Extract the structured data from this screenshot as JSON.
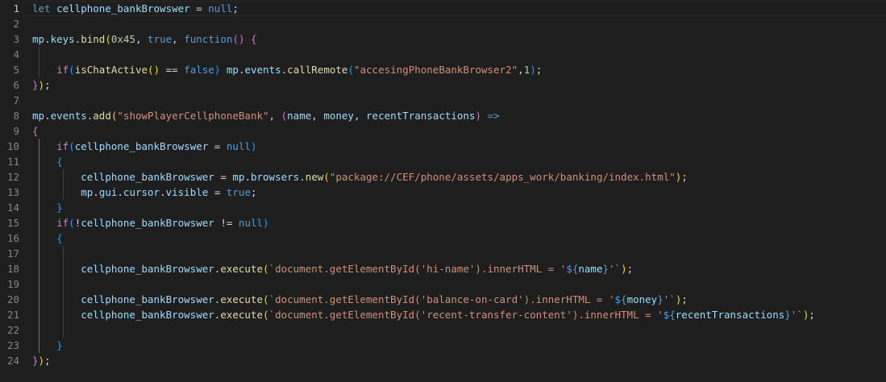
{
  "editor": {
    "language": "javascript",
    "active_line": 1,
    "line_numbers": [
      "1",
      "2",
      "3",
      "4",
      "5",
      "6",
      "7",
      "8",
      "9",
      "10",
      "11",
      "12",
      "13",
      "14",
      "15",
      "16",
      "17",
      "18",
      "19",
      "20",
      "21",
      "22",
      "23",
      "24"
    ],
    "lines": [
      [
        {
          "t": "let",
          "c": "kw"
        },
        {
          "t": " "
        },
        {
          "t": "cellphone_bankBrowswer",
          "c": "var"
        },
        {
          "t": " = "
        },
        {
          "t": "null",
          "c": "kw"
        },
        {
          "t": ";"
        }
      ],
      [],
      [
        {
          "t": "mp",
          "c": "var"
        },
        {
          "t": "."
        },
        {
          "t": "keys",
          "c": "var"
        },
        {
          "t": "."
        },
        {
          "t": "bind",
          "c": "fn"
        },
        {
          "t": "(",
          "c": "p1"
        },
        {
          "t": "0x45",
          "c": "num"
        },
        {
          "t": ", "
        },
        {
          "t": "true",
          "c": "kw"
        },
        {
          "t": ", "
        },
        {
          "t": "function",
          "c": "kw"
        },
        {
          "t": "()",
          "c": "p2"
        },
        {
          "t": " "
        },
        {
          "t": "{",
          "c": "p2"
        }
      ],
      [],
      [
        {
          "t": "    "
        },
        {
          "t": "if",
          "c": "ctl"
        },
        {
          "t": "(",
          "c": "p3"
        },
        {
          "t": "isChatActive",
          "c": "fn"
        },
        {
          "t": "()",
          "c": "p1"
        },
        {
          "t": " == "
        },
        {
          "t": "false",
          "c": "kw"
        },
        {
          "t": ")",
          "c": "p3"
        },
        {
          "t": " "
        },
        {
          "t": "mp",
          "c": "var"
        },
        {
          "t": "."
        },
        {
          "t": "events",
          "c": "var"
        },
        {
          "t": "."
        },
        {
          "t": "callRemote",
          "c": "fn"
        },
        {
          "t": "(",
          "c": "p3"
        },
        {
          "t": "\"accesingPhoneBankBrowser2\"",
          "c": "str"
        },
        {
          "t": ","
        },
        {
          "t": "1",
          "c": "num"
        },
        {
          "t": ")",
          "c": "p3"
        },
        {
          "t": ";"
        }
      ],
      [
        {
          "t": "}",
          "c": "p2"
        },
        {
          "t": ")",
          "c": "p1"
        },
        {
          "t": ";"
        }
      ],
      [],
      [
        {
          "t": "mp",
          "c": "var"
        },
        {
          "t": "."
        },
        {
          "t": "events",
          "c": "var"
        },
        {
          "t": "."
        },
        {
          "t": "add",
          "c": "fn"
        },
        {
          "t": "(",
          "c": "p1"
        },
        {
          "t": "\"showPlayerCellphoneBank\"",
          "c": "str"
        },
        {
          "t": ", "
        },
        {
          "t": "(",
          "c": "p2"
        },
        {
          "t": "name",
          "c": "var"
        },
        {
          "t": ", "
        },
        {
          "t": "money",
          "c": "var"
        },
        {
          "t": ", "
        },
        {
          "t": "recentTransactions",
          "c": "var"
        },
        {
          "t": ")",
          "c": "p2"
        },
        {
          "t": " "
        },
        {
          "t": "=>",
          "c": "kw"
        }
      ],
      [
        {
          "t": "{",
          "c": "p2"
        }
      ],
      [
        {
          "t": "    "
        },
        {
          "t": "if",
          "c": "ctl"
        },
        {
          "t": "(",
          "c": "p3"
        },
        {
          "t": "cellphone_bankBrowswer",
          "c": "var"
        },
        {
          "t": " = "
        },
        {
          "t": "null",
          "c": "kw"
        },
        {
          "t": ")",
          "c": "p3"
        }
      ],
      [
        {
          "t": "    "
        },
        {
          "t": "{",
          "c": "p3"
        }
      ],
      [
        {
          "t": "        "
        },
        {
          "t": "cellphone_bankBrowswer",
          "c": "var"
        },
        {
          "t": " = "
        },
        {
          "t": "mp",
          "c": "var"
        },
        {
          "t": "."
        },
        {
          "t": "browsers",
          "c": "var"
        },
        {
          "t": "."
        },
        {
          "t": "new",
          "c": "fn"
        },
        {
          "t": "(",
          "c": "p1"
        },
        {
          "t": "\"package://CEF/phone/assets/apps_work/banking/index.html\"",
          "c": "str"
        },
        {
          "t": ")",
          "c": "p1"
        },
        {
          "t": ";"
        }
      ],
      [
        {
          "t": "        "
        },
        {
          "t": "mp",
          "c": "var"
        },
        {
          "t": "."
        },
        {
          "t": "gui",
          "c": "var"
        },
        {
          "t": "."
        },
        {
          "t": "cursor",
          "c": "var"
        },
        {
          "t": "."
        },
        {
          "t": "visible",
          "c": "var"
        },
        {
          "t": " = "
        },
        {
          "t": "true",
          "c": "kw"
        },
        {
          "t": ";"
        }
      ],
      [
        {
          "t": "    "
        },
        {
          "t": "}",
          "c": "p3"
        }
      ],
      [
        {
          "t": "    "
        },
        {
          "t": "if",
          "c": "ctl"
        },
        {
          "t": "(",
          "c": "p3"
        },
        {
          "t": "!"
        },
        {
          "t": "cellphone_bankBrowswer",
          "c": "var"
        },
        {
          "t": " != "
        },
        {
          "t": "null",
          "c": "kw"
        },
        {
          "t": ")",
          "c": "p3"
        }
      ],
      [
        {
          "t": "    "
        },
        {
          "t": "{",
          "c": "p3"
        }
      ],
      [],
      [
        {
          "t": "        "
        },
        {
          "t": "cellphone_bankBrowswer",
          "c": "var"
        },
        {
          "t": "."
        },
        {
          "t": "execute",
          "c": "fn"
        },
        {
          "t": "(",
          "c": "p1"
        },
        {
          "t": "`document.getElementById('hi-name').innerHTML = '",
          "c": "str"
        },
        {
          "t": "${",
          "c": "tpl"
        },
        {
          "t": "name",
          "c": "var"
        },
        {
          "t": "}",
          "c": "tpl"
        },
        {
          "t": "'`",
          "c": "str"
        },
        {
          "t": ")",
          "c": "p1"
        },
        {
          "t": ";"
        }
      ],
      [],
      [
        {
          "t": "        "
        },
        {
          "t": "cellphone_bankBrowswer",
          "c": "var"
        },
        {
          "t": "."
        },
        {
          "t": "execute",
          "c": "fn"
        },
        {
          "t": "(",
          "c": "p1"
        },
        {
          "t": "`document.getElementById('balance-on-card').innerHTML = '",
          "c": "str"
        },
        {
          "t": "${",
          "c": "tpl"
        },
        {
          "t": "money",
          "c": "var"
        },
        {
          "t": "}",
          "c": "tpl"
        },
        {
          "t": "'`",
          "c": "str"
        },
        {
          "t": ")",
          "c": "p1"
        },
        {
          "t": ";"
        }
      ],
      [
        {
          "t": "        "
        },
        {
          "t": "cellphone_bankBrowswer",
          "c": "var"
        },
        {
          "t": "."
        },
        {
          "t": "execute",
          "c": "fn"
        },
        {
          "t": "(",
          "c": "p1"
        },
        {
          "t": "`document.getElementById('recent-transfer-content').innerHTML = '",
          "c": "str"
        },
        {
          "t": "${",
          "c": "tpl"
        },
        {
          "t": "recentTransactions",
          "c": "var"
        },
        {
          "t": "}",
          "c": "tpl"
        },
        {
          "t": "'`",
          "c": "str"
        },
        {
          "t": ")",
          "c": "p1"
        },
        {
          "t": ";"
        }
      ],
      [],
      [
        {
          "t": "    "
        },
        {
          "t": "}",
          "c": "p3"
        }
      ],
      [
        {
          "t": "}",
          "c": "p2"
        },
        {
          "t": ")",
          "c": "p1"
        },
        {
          "t": ";"
        }
      ]
    ]
  },
  "colors": {
    "background": "#1e1e1e",
    "line_number": "#858585",
    "line_number_active": "#c6c6c6",
    "keyword": "#569cd6",
    "control": "#c586c0",
    "variable": "#9cdcfe",
    "function": "#dcdcaa",
    "string": "#ce9178",
    "number": "#b5cea8",
    "bracket_1": "#ffd700",
    "bracket_2": "#da70d6",
    "bracket_3": "#179fff"
  }
}
